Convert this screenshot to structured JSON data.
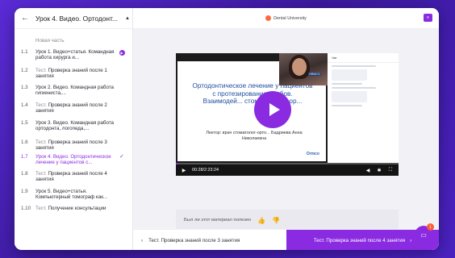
{
  "sidebar": {
    "title": "Урок 4. Видео. Ортодонт...",
    "section": "Новая часть",
    "items": [
      {
        "num": "1.1",
        "kind": "",
        "text": "Урок 1. Видео+статья. Командная работа хирурга и...",
        "state": "playing"
      },
      {
        "num": "1.2",
        "kind": "Тест.",
        "text": " Проверка знаний после 1 занятия",
        "state": ""
      },
      {
        "num": "1.3",
        "kind": "",
        "text": "Урок 2. Видео. Командная работа гигиениста,...",
        "state": ""
      },
      {
        "num": "1.4",
        "kind": "Тест.",
        "text": " Проверка знаний после 2 занятия",
        "state": ""
      },
      {
        "num": "1.5",
        "kind": "",
        "text": "Урок 3. Видео. Командная работа ортодонта, логопеда,...",
        "state": ""
      },
      {
        "num": "1.6",
        "kind": "Тест.",
        "text": " Проверка знаний после 3 занятия",
        "state": ""
      },
      {
        "num": "1.7",
        "kind": "",
        "text": "Урок 4. Видео. Ортодонтическое лечение у пациентов с...",
        "state": "active"
      },
      {
        "num": "1.8",
        "kind": "Тест.",
        "text": " Проверка знаний после 4 занятия",
        "state": ""
      },
      {
        "num": "1.9",
        "kind": "",
        "text": "Урок 5. Видео+статья. Компьютерный томограф как...",
        "state": ""
      },
      {
        "num": "1.10",
        "kind": "Тест.",
        "text": " Получение консультации",
        "state": ""
      }
    ]
  },
  "header": {
    "logo_text": "Dental University"
  },
  "video": {
    "slide_title": "Ортодонтическое лечение у пациентов с протезированием зубов. Взаимодей... стоматологом-ор...",
    "slide_lector": "Лектор: врач стоматолог-орто... Бадриева Анна Николаевна",
    "brand": "Ormco",
    "time": "00:28/2:23:24",
    "progress": 0.01,
    "cam_tag": "ORMCO",
    "chat_head": "Чат"
  },
  "feedback": {
    "question": "Был ли этот материал полезен"
  },
  "nav": {
    "prev_label": "Тест. Проверка знаний после 3 занятия",
    "next_label": "Тест. Проверка знаний после 4 занятия"
  },
  "support": {
    "badge": "1"
  },
  "colors": {
    "accent": "#8a2be2",
    "background": "#4a21c0"
  }
}
